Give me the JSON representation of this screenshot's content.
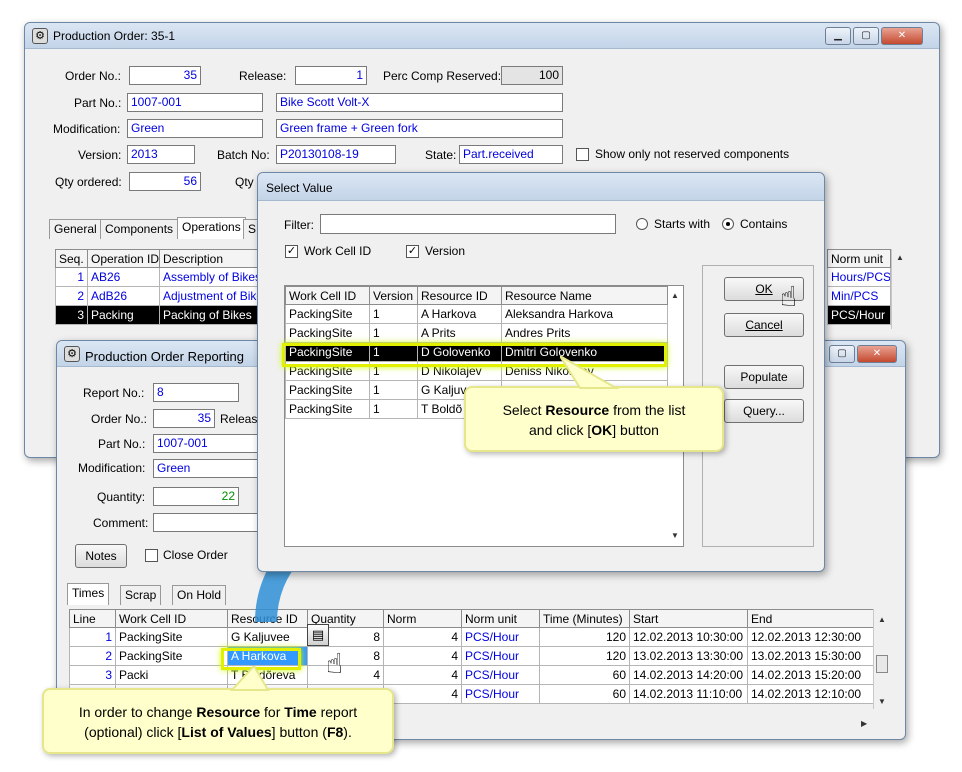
{
  "po_window": {
    "title": "Production Order: 35-1",
    "order_no_label": "Order No.:",
    "order_no": "35",
    "release_label": "Release:",
    "release": "1",
    "perc_label": "Perc Comp Reserved:",
    "perc": "100",
    "part_no_label": "Part No.:",
    "part_no": "1007-001",
    "part_desc": "Bike Scott Volt-X",
    "modification_label": "Modification:",
    "modification": "Green",
    "modification_desc": "Green frame + Green fork",
    "version_label": "Version:",
    "version": "2013",
    "batch_label": "Batch No:",
    "batch": "P20130108-19",
    "state_label": "State:",
    "state": "Part.received",
    "show_label": "Show only not reserved components",
    "qty_label": "Qty ordered:",
    "qty": "56",
    "qty2_label": "Qty r",
    "tabs": [
      "General",
      "Components",
      "Operations",
      "S"
    ],
    "ops_headers": [
      "Seq.",
      "Operation ID",
      "Description"
    ],
    "ops_rows": [
      [
        "1",
        "AB26",
        "Assembly of Bikes"
      ],
      [
        "2",
        "AdB26",
        "Adjustment of Bike"
      ],
      [
        "3",
        "Packing",
        "Packing of Bikes"
      ]
    ],
    "norm_header": "Norm unit",
    "norm_values": [
      "Hours/PCS",
      "Min/PCS",
      "PCS/Hour"
    ]
  },
  "rep_window": {
    "title": "Production Order Reporting",
    "report_label": "Report No.:",
    "report": "8",
    "order_label": "Order No.:",
    "order": "35",
    "release_label": "Releas",
    "part_label": "Part No.:",
    "part": "1007-001",
    "mod_label": "Modification:",
    "mod": "Green",
    "qty_label": "Quantity:",
    "qty": "22",
    "comment_label": "Comment:",
    "notes_btn": "Notes",
    "close_order_label": "Close Order",
    "tabs": [
      "Times",
      "Scrap",
      "On Hold"
    ],
    "headers": [
      "Line",
      "Work Cell ID",
      "Resource ID",
      "Quantity",
      "Norm",
      "Norm unit",
      "Time (Minutes)",
      "Start",
      "End"
    ],
    "rows": [
      [
        "1",
        "PackingSite",
        "G Kaljuvee",
        "8",
        "4",
        "PCS/Hour",
        "120",
        "12.02.2013 10:30:00",
        "12.02.2013 12:30:00"
      ],
      [
        "2",
        "PackingSite",
        "A Harkova",
        "8",
        "4",
        "PCS/Hour",
        "120",
        "13.02.2013 13:30:00",
        "13.02.2013 15:30:00"
      ],
      [
        "3",
        "Packi",
        "T Boldõreva",
        "4",
        "4",
        "PCS/Hour",
        "60",
        "14.02.2013 14:20:00",
        "14.02.2013 15:20:00"
      ],
      [
        "",
        "",
        "",
        "",
        "4",
        "PCS/Hour",
        "60",
        "14.02.2013 11:10:00",
        "14.02.2013 12:10:00"
      ]
    ]
  },
  "select_dialog": {
    "title": "Select Value",
    "filter_label": "Filter:",
    "starts_with": "Starts with",
    "contains": "Contains",
    "chk_workcell": "Work Cell ID",
    "chk_version": "Version",
    "headers": [
      "Work Cell ID",
      "Version",
      "Resource ID",
      "Resource Name"
    ],
    "rows": [
      [
        "PackingSite",
        "1",
        "A Harkova",
        "Aleksandra Harkova"
      ],
      [
        "PackingSite",
        "1",
        "A Prits",
        "Andres Prits"
      ],
      [
        "PackingSite",
        "1",
        "D Golovenko",
        "Dmitri Golovenko"
      ],
      [
        "PackingSite",
        "1",
        "D Nikolajev",
        "Deniss Nikolajev"
      ],
      [
        "PackingSite",
        "1",
        "G Kaljuv",
        ""
      ],
      [
        "PackingSite",
        "1",
        "T Boldõ",
        ""
      ]
    ],
    "ok": "OK",
    "cancel": "Cancel",
    "populate": "Populate",
    "query": "Query..."
  },
  "callouts": {
    "select_a": "Select ",
    "select_b": "Resource",
    "select_c": " from the list",
    "select_d": "and click [",
    "select_e": "OK",
    "select_f": "] button",
    "change_a": "In order to change ",
    "change_b": "Resource",
    "change_c": " for ",
    "change_d": "Time",
    "change_e": " report",
    "change_f": "(optional) click [",
    "change_g": "List of Values",
    "change_h": "] button (",
    "change_i": "F8",
    "change_j": ")."
  },
  "colors": {
    "accent_blue": "#0000e0",
    "callout_bg": "#ffffcc",
    "highlight": "#e0f000",
    "arrow": "#2e8fd6"
  }
}
